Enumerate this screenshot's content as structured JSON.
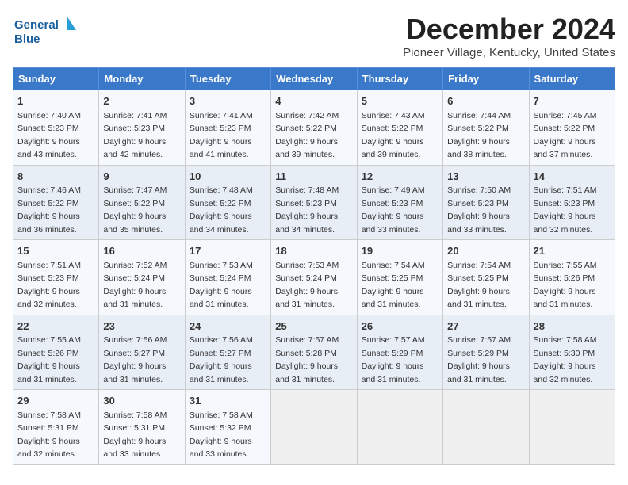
{
  "logo": {
    "line1": "General",
    "line2": "Blue"
  },
  "title": "December 2024",
  "subtitle": "Pioneer Village, Kentucky, United States",
  "weekdays": [
    "Sunday",
    "Monday",
    "Tuesday",
    "Wednesday",
    "Thursday",
    "Friday",
    "Saturday"
  ],
  "weeks": [
    [
      {
        "day": 1,
        "info": "Sunrise: 7:40 AM\nSunset: 5:23 PM\nDaylight: 9 hours\nand 43 minutes."
      },
      {
        "day": 2,
        "info": "Sunrise: 7:41 AM\nSunset: 5:23 PM\nDaylight: 9 hours\nand 42 minutes."
      },
      {
        "day": 3,
        "info": "Sunrise: 7:41 AM\nSunset: 5:23 PM\nDaylight: 9 hours\nand 41 minutes."
      },
      {
        "day": 4,
        "info": "Sunrise: 7:42 AM\nSunset: 5:22 PM\nDaylight: 9 hours\nand 39 minutes."
      },
      {
        "day": 5,
        "info": "Sunrise: 7:43 AM\nSunset: 5:22 PM\nDaylight: 9 hours\nand 39 minutes."
      },
      {
        "day": 6,
        "info": "Sunrise: 7:44 AM\nSunset: 5:22 PM\nDaylight: 9 hours\nand 38 minutes."
      },
      {
        "day": 7,
        "info": "Sunrise: 7:45 AM\nSunset: 5:22 PM\nDaylight: 9 hours\nand 37 minutes."
      }
    ],
    [
      {
        "day": 8,
        "info": "Sunrise: 7:46 AM\nSunset: 5:22 PM\nDaylight: 9 hours\nand 36 minutes."
      },
      {
        "day": 9,
        "info": "Sunrise: 7:47 AM\nSunset: 5:22 PM\nDaylight: 9 hours\nand 35 minutes."
      },
      {
        "day": 10,
        "info": "Sunrise: 7:48 AM\nSunset: 5:22 PM\nDaylight: 9 hours\nand 34 minutes."
      },
      {
        "day": 11,
        "info": "Sunrise: 7:48 AM\nSunset: 5:23 PM\nDaylight: 9 hours\nand 34 minutes."
      },
      {
        "day": 12,
        "info": "Sunrise: 7:49 AM\nSunset: 5:23 PM\nDaylight: 9 hours\nand 33 minutes."
      },
      {
        "day": 13,
        "info": "Sunrise: 7:50 AM\nSunset: 5:23 PM\nDaylight: 9 hours\nand 33 minutes."
      },
      {
        "day": 14,
        "info": "Sunrise: 7:51 AM\nSunset: 5:23 PM\nDaylight: 9 hours\nand 32 minutes."
      }
    ],
    [
      {
        "day": 15,
        "info": "Sunrise: 7:51 AM\nSunset: 5:23 PM\nDaylight: 9 hours\nand 32 minutes."
      },
      {
        "day": 16,
        "info": "Sunrise: 7:52 AM\nSunset: 5:24 PM\nDaylight: 9 hours\nand 31 minutes."
      },
      {
        "day": 17,
        "info": "Sunrise: 7:53 AM\nSunset: 5:24 PM\nDaylight: 9 hours\nand 31 minutes."
      },
      {
        "day": 18,
        "info": "Sunrise: 7:53 AM\nSunset: 5:24 PM\nDaylight: 9 hours\nand 31 minutes."
      },
      {
        "day": 19,
        "info": "Sunrise: 7:54 AM\nSunset: 5:25 PM\nDaylight: 9 hours\nand 31 minutes."
      },
      {
        "day": 20,
        "info": "Sunrise: 7:54 AM\nSunset: 5:25 PM\nDaylight: 9 hours\nand 31 minutes."
      },
      {
        "day": 21,
        "info": "Sunrise: 7:55 AM\nSunset: 5:26 PM\nDaylight: 9 hours\nand 31 minutes."
      }
    ],
    [
      {
        "day": 22,
        "info": "Sunrise: 7:55 AM\nSunset: 5:26 PM\nDaylight: 9 hours\nand 31 minutes."
      },
      {
        "day": 23,
        "info": "Sunrise: 7:56 AM\nSunset: 5:27 PM\nDaylight: 9 hours\nand 31 minutes."
      },
      {
        "day": 24,
        "info": "Sunrise: 7:56 AM\nSunset: 5:27 PM\nDaylight: 9 hours\nand 31 minutes."
      },
      {
        "day": 25,
        "info": "Sunrise: 7:57 AM\nSunset: 5:28 PM\nDaylight: 9 hours\nand 31 minutes."
      },
      {
        "day": 26,
        "info": "Sunrise: 7:57 AM\nSunset: 5:29 PM\nDaylight: 9 hours\nand 31 minutes."
      },
      {
        "day": 27,
        "info": "Sunrise: 7:57 AM\nSunset: 5:29 PM\nDaylight: 9 hours\nand 31 minutes."
      },
      {
        "day": 28,
        "info": "Sunrise: 7:58 AM\nSunset: 5:30 PM\nDaylight: 9 hours\nand 32 minutes."
      }
    ],
    [
      {
        "day": 29,
        "info": "Sunrise: 7:58 AM\nSunset: 5:31 PM\nDaylight: 9 hours\nand 32 minutes."
      },
      {
        "day": 30,
        "info": "Sunrise: 7:58 AM\nSunset: 5:31 PM\nDaylight: 9 hours\nand 33 minutes."
      },
      {
        "day": 31,
        "info": "Sunrise: 7:58 AM\nSunset: 5:32 PM\nDaylight: 9 hours\nand 33 minutes."
      },
      null,
      null,
      null,
      null
    ]
  ]
}
